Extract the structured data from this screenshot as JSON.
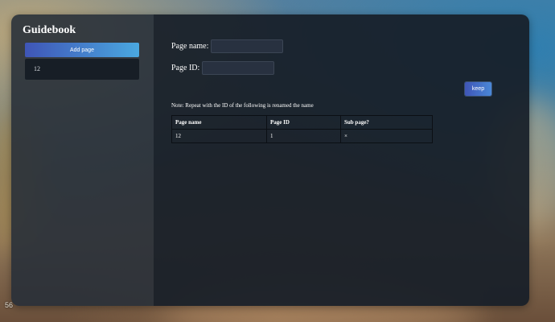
{
  "app": {
    "title": "Guidebook"
  },
  "sidebar": {
    "add_page_label": "Add page",
    "pages": [
      "12"
    ]
  },
  "form": {
    "page_name_label": "Page name:",
    "page_name_value": "",
    "page_id_label": "Page ID:",
    "page_id_value": "",
    "keep_label": "keep"
  },
  "note": "Note: Repeat with the ID of the following is renamed the name",
  "table": {
    "headers": [
      "Page name",
      "Page ID",
      "Sub page?"
    ],
    "rows": [
      [
        "12",
        "1",
        "×"
      ]
    ]
  },
  "overlay": {
    "corner_text": "56"
  },
  "colors": {
    "accent_start": "#3f55b6",
    "accent_end": "#4aa8e0",
    "panel": "#171e28",
    "sidebar": "#262e38"
  }
}
